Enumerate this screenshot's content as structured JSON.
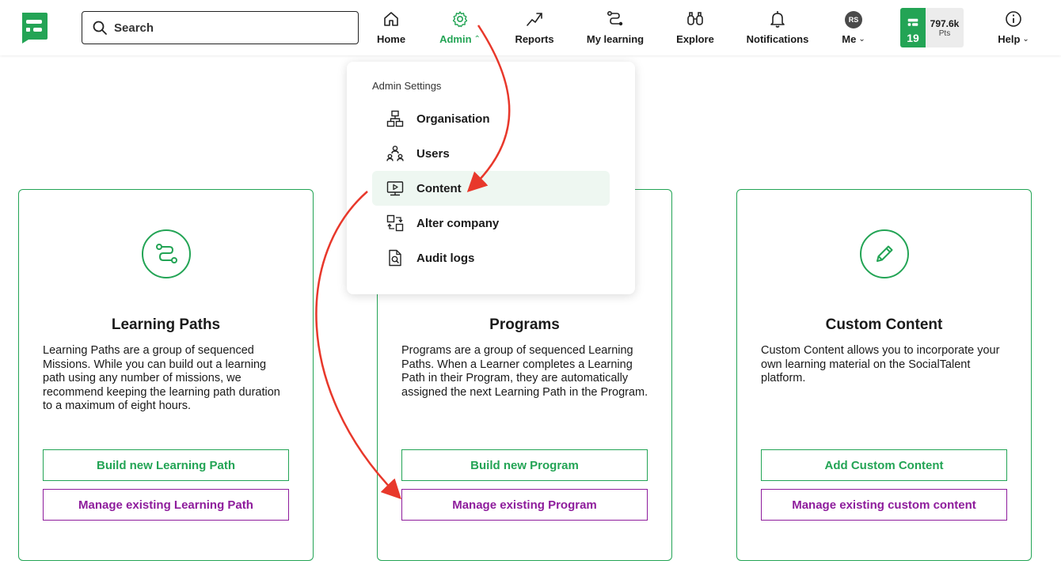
{
  "search": {
    "placeholder": "Search"
  },
  "nav": {
    "home": "Home",
    "admin": "Admin",
    "reports": "Reports",
    "my_learning": "My learning",
    "explore": "Explore",
    "notifications": "Notifications",
    "me": "Me",
    "me_initials": "RS",
    "help": "Help"
  },
  "points": {
    "level": "19",
    "value": "797.6k",
    "unit": "Pts"
  },
  "dropdown": {
    "header": "Admin Settings",
    "items": [
      {
        "label": "Organisation",
        "icon": "organisation-icon"
      },
      {
        "label": "Users",
        "icon": "users-icon"
      },
      {
        "label": "Content",
        "icon": "content-icon"
      },
      {
        "label": "Alter company",
        "icon": "alter-company-icon"
      },
      {
        "label": "Audit logs",
        "icon": "audit-logs-icon"
      }
    ],
    "active_item": "Content"
  },
  "cards": [
    {
      "title": "Learning Paths",
      "description": "Learning Paths are a group of sequenced Missions. While you can build out a learning path using any number of missions, we recommend keeping the learning path duration to a maximum of eight hours.",
      "build_label": "Build new Learning Path",
      "manage_label": "Manage existing Learning Path",
      "icon": "learning-path-icon"
    },
    {
      "title": "Programs",
      "description": "Programs are a group of sequenced Learning Paths. When a Learner completes a Learning Path in their Program, they are automatically assigned the next Learning Path in the Program.",
      "build_label": "Build new Program",
      "manage_label": "Manage existing Program",
      "icon": "program-icon"
    },
    {
      "title": "Custom Content",
      "description": "Custom Content allows you to incorporate your own learning material on the SocialTalent platform.",
      "build_label": "Add Custom Content",
      "manage_label": "Manage existing custom content",
      "icon": "pencil-icon"
    }
  ],
  "colors": {
    "brand_green": "#23a455",
    "manage_purple": "#8e1c9c",
    "annotation_red": "#e8382b"
  }
}
